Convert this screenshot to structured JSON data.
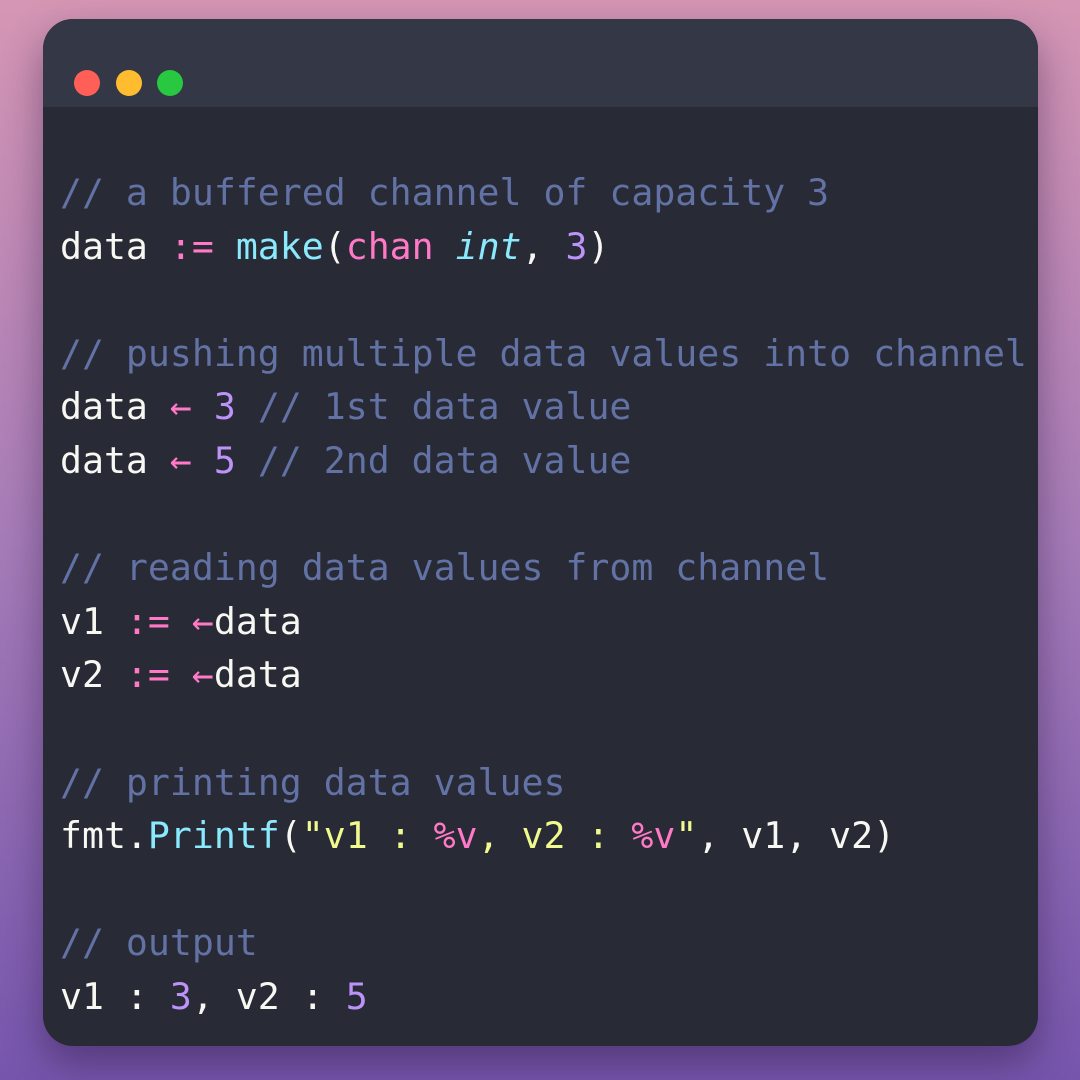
{
  "code": {
    "comment_buffered": "// a buffered channel of capacity 3",
    "make_line": {
      "var": "data",
      "op": ":=",
      "func": "make",
      "open": "(",
      "kw_chan": "chan",
      "type_int": "int",
      "comma": ",",
      "num": "3",
      "close": ")"
    },
    "comment_pushing": "// pushing multiple data values into channel",
    "push1": {
      "var": "data",
      "arrow": "←",
      "num": "3",
      "comment": "// 1st data value"
    },
    "push2": {
      "var": "data",
      "arrow": "←",
      "num": "5",
      "comment": "// 2nd data value"
    },
    "comment_reading": "// reading data values from channel",
    "read1": {
      "var": "v1",
      "op": ":=",
      "arrow": "←",
      "src": "data"
    },
    "read2": {
      "var": "v2",
      "op": ":=",
      "arrow": "←",
      "src": "data"
    },
    "comment_printing": "// printing data values",
    "printf_line": {
      "pkg": "fmt.",
      "func": "Printf",
      "open": "(",
      "quote_open": "\"",
      "str_part1": "v1 : ",
      "verb1": "%v",
      "str_part2": ", v2 : ",
      "verb2": "%v",
      "quote_close": "\"",
      "args": ", v1, v2",
      "close": ")"
    },
    "comment_output": "// output",
    "output_line": {
      "part1": "v1 : ",
      "num1": "3",
      "part2": ", v2 : ",
      "num2": "5"
    }
  },
  "colors": {
    "comment": "#6272a4",
    "keyword": "#ff79c6",
    "function": "#8be9fd",
    "number": "#bd93f9",
    "string": "#f1fa8c",
    "text": "#f8f8f2",
    "editor_bg": "#282a36",
    "titlebar_bg": "#343746"
  },
  "window_controls": [
    "close-dot-red",
    "minimize-dot-yellow",
    "maximize-dot-green"
  ]
}
